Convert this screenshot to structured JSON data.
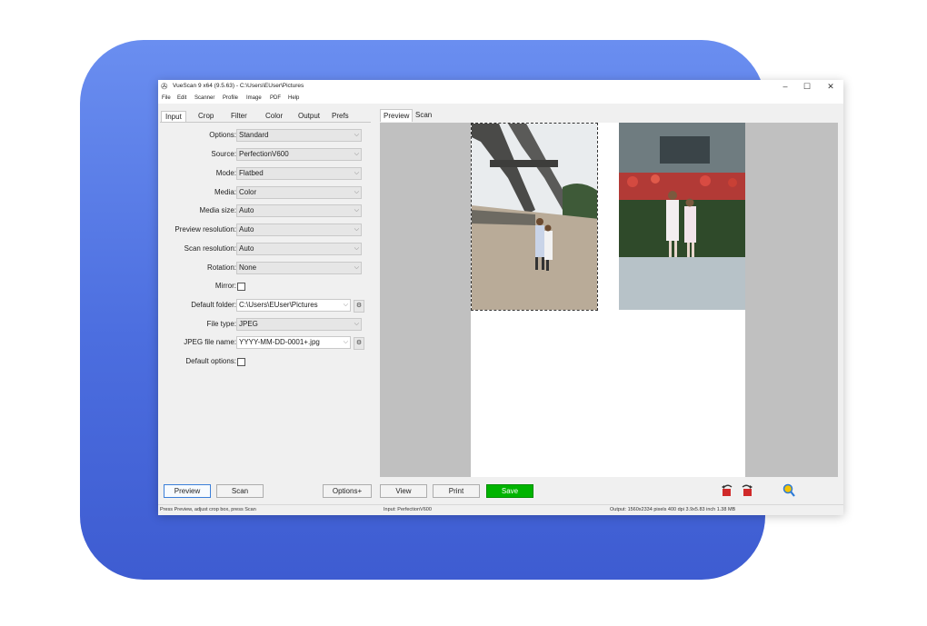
{
  "window": {
    "title": "VueScan 9 x64 (9.5.63) - C:\\Users\\EUser\\Pictures",
    "controls": [
      "–",
      "☐",
      "✕"
    ]
  },
  "menu": [
    "File",
    "Edit",
    "Scanner",
    "Profile",
    "Image",
    "PDF",
    "Help"
  ],
  "left_tabs": [
    {
      "label": "Input",
      "active": true
    },
    {
      "label": "Crop",
      "active": false
    },
    {
      "label": "Filter",
      "active": false
    },
    {
      "label": "Color",
      "active": false
    },
    {
      "label": "Output",
      "active": false
    },
    {
      "label": "Prefs",
      "active": false
    }
  ],
  "input_form": {
    "options": {
      "label": "Options:",
      "value": "Standard"
    },
    "source": {
      "label": "Source:",
      "value": "PerfectionV600"
    },
    "mode": {
      "label": "Mode:",
      "value": "Flatbed"
    },
    "media": {
      "label": "Media:",
      "value": "Color"
    },
    "media_size": {
      "label": "Media size:",
      "value": "Auto"
    },
    "preview_resolution": {
      "label": "Preview resolution:",
      "value": "Auto"
    },
    "scan_resolution": {
      "label": "Scan resolution:",
      "value": "Auto"
    },
    "rotation": {
      "label": "Rotation:",
      "value": "None"
    },
    "mirror": {
      "label": "Mirror:",
      "checked": false
    },
    "default_folder": {
      "label": "Default folder:",
      "value": "C:\\Users\\EUser\\Pictures"
    },
    "file_type": {
      "label": "File type:",
      "value": "JPEG"
    },
    "jpeg_file_name": {
      "label": "JPEG file name:",
      "value": "YYYY-MM-DD-0001+.jpg"
    },
    "default_options": {
      "label": "Default options:",
      "checked": false
    }
  },
  "right_tabs": [
    {
      "label": "Preview",
      "active": true
    },
    {
      "label": "Scan",
      "active": false
    }
  ],
  "buttons": {
    "preview": "Preview",
    "scan": "Scan",
    "options": "Options+",
    "view": "View",
    "print": "Print",
    "save": "Save"
  },
  "icons": {
    "rotate_left": "rotate-left-icon",
    "rotate_right": "rotate-right-icon",
    "zoom": "zoom-in-icon"
  },
  "status": {
    "left": "Press Preview, adjust crop box, press Scan",
    "middle": "Input: PerfectionV600",
    "right": "Output: 1560x2334 pixels 400 dpi 3.9x5.83 inch 1.38 MB"
  },
  "colors": {
    "background_card": "#4c6edf",
    "save_button": "#00b400"
  }
}
